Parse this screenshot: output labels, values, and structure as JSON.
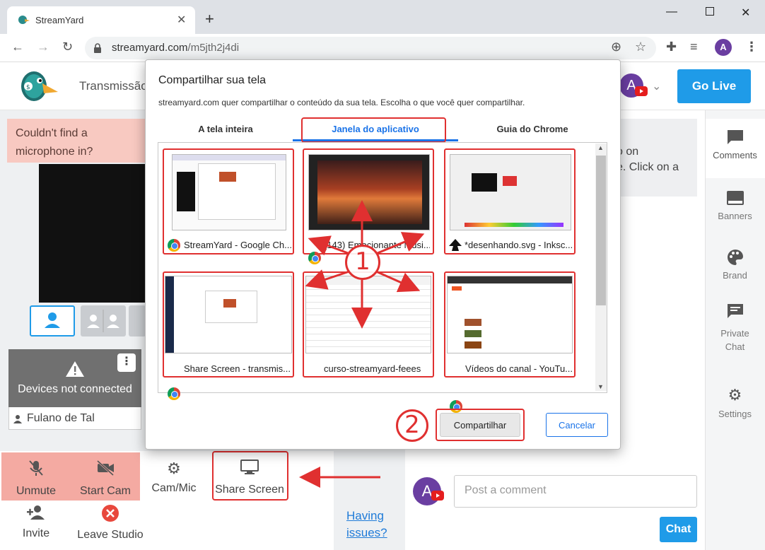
{
  "browser": {
    "tab_title": "StreamYard",
    "url_domain": "streamyard.com",
    "url_path": "/m5jth2j4di",
    "profile_initial": "A"
  },
  "header": {
    "nav_label": "Transmissão",
    "avatar_initial": "A",
    "go_live": "Go Live"
  },
  "warning": {
    "text": "Couldn't find a microphone in?"
  },
  "devices": {
    "status": "Devices not connected",
    "participant": "Fulano de Tal"
  },
  "controls": {
    "unmute": "Unmute",
    "start_cam": "Start Cam",
    "cam_mic": "Cam/Mic",
    "share_screen": "Share Screen",
    "invite": "Invite",
    "leave": "Leave Studio",
    "having_issues_1": "Having",
    "having_issues_2": "issues?"
  },
  "info_card": {
    "line1": "o on",
    "line2": "e. Click on a"
  },
  "sidebar": {
    "comments": "Comments",
    "banners": "Banners",
    "brand": "Brand",
    "private_1": "Private",
    "private_2": "Chat",
    "settings": "Settings"
  },
  "comment": {
    "avatar_initial": "A",
    "placeholder": "Post a comment",
    "chat_button": "Chat"
  },
  "dialog": {
    "title": "Compartilhar sua tela",
    "description": "streamyard.com quer compartilhar o conteúdo da sua tela. Escolha o que você quer compartilhar.",
    "tabs": [
      "A tela inteira",
      "Janela do aplicativo",
      "Guia do Chrome"
    ],
    "windows": [
      {
        "label": "StreamYard - Google Ch..."
      },
      {
        "label": "(143) Emocionante Músi..."
      },
      {
        "label": "*desenhando.svg - Inksc..."
      },
      {
        "label": "Share Screen - transmis..."
      },
      {
        "label": "curso-streamyard-feees"
      },
      {
        "label": "Vídeos do canal - YouTu..."
      }
    ],
    "share_button": "Compartilhar",
    "cancel_button": "Cancelar"
  },
  "annotations": {
    "step1": "1",
    "step2": "2"
  },
  "colors": {
    "accent": "#1f9be8",
    "annotation_red": "#e03030",
    "warning_bg": "#f8c9c1"
  }
}
